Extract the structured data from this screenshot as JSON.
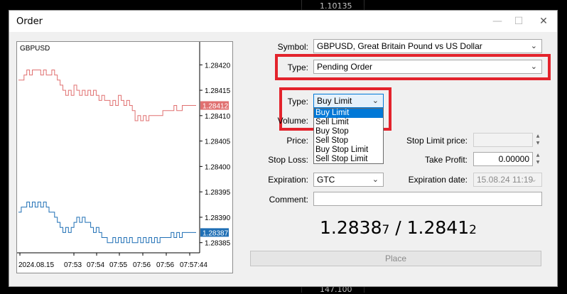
{
  "background": {
    "prices": [
      "1.10135",
      "147.100"
    ]
  },
  "window": {
    "title": "Order",
    "minimize_glyph": "—",
    "maximize_glyph": "☐",
    "close_glyph": "✕"
  },
  "chart": {
    "symbol": "GBPUSD",
    "y_ticks": [
      "1.28420",
      "1.28415",
      "1.28410",
      "1.28405",
      "1.28400",
      "1.28395",
      "1.28390",
      "1.28385"
    ],
    "ask_label": "1.28412",
    "bid_label": "1.28387",
    "x_ticks": [
      "2024.08.15",
      "07:53",
      "07:54",
      "07:55",
      "07:56",
      "07:56",
      "07:57:44"
    ],
    "ask_color": "#e07070",
    "bid_color": "#1f6fb5",
    "ask_series": [
      1.28417,
      1.28417,
      1.28418,
      1.28419,
      1.28418,
      1.28419,
      1.28419,
      1.28419,
      1.28418,
      1.28419,
      1.28418,
      1.28418,
      1.28419,
      1.28418,
      1.28417,
      1.28416,
      1.28415,
      1.28414,
      1.28415,
      1.28414,
      1.28416,
      1.28415,
      1.28414,
      1.28415,
      1.28414,
      1.28415,
      1.28414,
      1.28415,
      1.28414,
      1.28413,
      1.28414,
      1.28413,
      1.28413,
      1.28412,
      1.28413,
      1.28412,
      1.28414,
      1.28413,
      1.28412,
      1.28413,
      1.28412,
      1.28411,
      1.28409,
      1.2841,
      1.28409,
      1.2841,
      1.28409,
      1.2841,
      1.2841,
      1.2841,
      1.2841,
      1.2841,
      1.28411,
      1.28411,
      1.28411,
      1.28411,
      1.28412,
      1.28411,
      1.28411,
      1.28412,
      1.28412,
      1.28412,
      1.28412,
      1.28412,
      1.28412
    ],
    "bid_series": [
      1.28391,
      1.28392,
      1.28392,
      1.28393,
      1.28392,
      1.28393,
      1.28392,
      1.28393,
      1.28392,
      1.28393,
      1.28392,
      1.28391,
      1.28391,
      1.2839,
      1.28389,
      1.28388,
      1.28387,
      1.28388,
      1.28387,
      1.28388,
      1.28389,
      1.2839,
      1.28389,
      1.2839,
      1.28389,
      1.28389,
      1.28388,
      1.28387,
      1.28388,
      1.28387,
      1.28386,
      1.28386,
      1.28385,
      1.28385,
      1.28386,
      1.28385,
      1.28386,
      1.28385,
      1.28386,
      1.28385,
      1.28386,
      1.28385,
      1.28385,
      1.28386,
      1.28385,
      1.28386,
      1.28385,
      1.28386,
      1.28385,
      1.28386,
      1.28385,
      1.28386,
      1.28386,
      1.28386,
      1.28386,
      1.28387,
      1.28386,
      1.28387,
      1.28386,
      1.28387,
      1.28387,
      1.28387,
      1.28387,
      1.28387,
      1.28387
    ]
  },
  "form": {
    "symbol_label": "Symbol:",
    "symbol_value": "GBPUSD, Great Britain Pound vs US Dollar",
    "type_label": "Type:",
    "type_value": "Pending Order",
    "type2_label": "Type:",
    "type2_value": "Buy Limit",
    "volume_label": "Volume:",
    "price_label": "Price:",
    "stop_limit_label": "Stop Limit price:",
    "stop_loss_label": "Stop Loss:",
    "take_profit_label": "Take Profit:",
    "take_profit_value": "0.00000",
    "expiration_label": "Expiration:",
    "expiration_value": "GTC",
    "expiration_date_label": "Expiration date:",
    "expiration_date_value": "15.08.24 11:19",
    "comment_label": "Comment:",
    "comment_value": "",
    "dropdown_options": [
      "Buy Limit",
      "Sell Limit",
      "Buy Stop",
      "Sell Stop",
      "Buy Stop Limit",
      "Sell Stop Limit"
    ],
    "bid_main": "1.2838",
    "bid_small": "7",
    "separator": " / ",
    "ask_main": "1.2841",
    "ask_small": "2",
    "place_label": "Place"
  },
  "colors": {
    "highlight": "#e3232c",
    "selection": "#0078d7"
  }
}
